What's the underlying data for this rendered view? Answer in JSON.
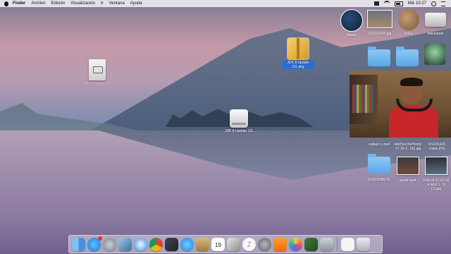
{
  "menubar": {
    "app_name": "Finder",
    "items": [
      "Archivo",
      "Edición",
      "Visualización",
      "Ir",
      "Ventana",
      "Ayuda"
    ],
    "clock": "Mié 10:27"
  },
  "desktop": {
    "icons": [
      {
        "label": "JDK 8 Update 111",
        "icon": "disk-image-icon"
      },
      {
        "label": "JDK 8 Update 111.pkg",
        "icon": "package-icon"
      },
      {
        "label": "JDK 8 Update 111",
        "icon": "mounted-drive-icon"
      },
      {
        "label": "Steam",
        "icon": "steam-icon"
      },
      {
        "label": "DSC01426.jpg",
        "icon": "photo-thumbnail"
      },
      {
        "label": "Keka",
        "icon": "keka-icon"
      },
      {
        "label": "Macintosh",
        "icon": "hard-drive-icon"
      },
      {
        "label": "outlast 1.mp4",
        "icon": "video-thumbnail"
      },
      {
        "label": "AddTextToPhoto( 17-10-2...56).jpg",
        "icon": "photo-thumbnail"
      },
      {
        "label": "DSC01420 copia.JPG",
        "icon": "photo-thumbnail"
      },
      {
        "label": "SUSCRIBETE",
        "icon": "folder-icon"
      },
      {
        "label": "pendi.mp4",
        "icon": "video-thumbnail"
      },
      {
        "label": "Foto el 11-10-16 a la(s) 1...9 (1).jpg",
        "icon": "photo-thumbnail"
      }
    ]
  },
  "dock": {
    "calendar_day": "19",
    "music_glyph": "♪",
    "items": [
      "finder-icon",
      "app-store-icon",
      "launchpad-icon",
      "preview-icon",
      "safari-icon",
      "chrome-icon",
      "gpu-monitor-icon",
      "messages-icon",
      "notes-icon",
      "calendar-icon",
      "photo-booth-icon",
      "music-icon",
      "system-preferences-icon",
      "ibooks-icon",
      "photos-icon",
      "camtasia-icon",
      "downloads-stack-icon",
      "document-stack-icon",
      "trash-icon"
    ]
  }
}
